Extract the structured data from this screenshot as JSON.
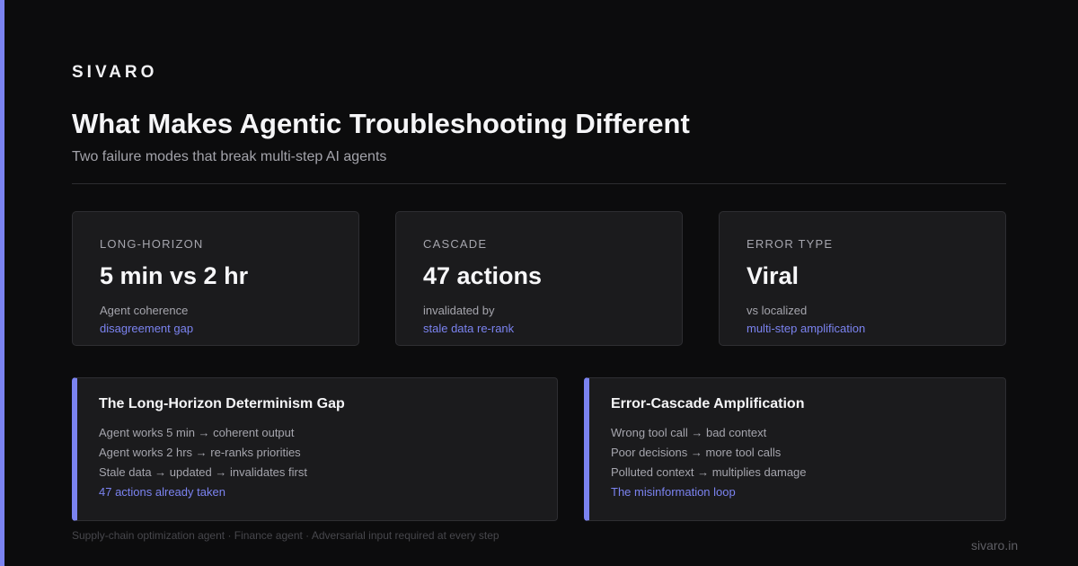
{
  "brand": "SIVARO",
  "title": "What Makes Agentic Troubleshooting Different",
  "subtitle": "Two failure modes that break multi-step AI agents",
  "accent_color": "#7b83f0",
  "stats": [
    {
      "label": "LONG-HORIZON",
      "value": "5 min vs 2 hr",
      "desc": "Agent coherence",
      "link": "disagreement gap"
    },
    {
      "label": "CASCADE",
      "value": "47 actions",
      "desc": "invalidated by",
      "link": "stale data re-rank"
    },
    {
      "label": "ERROR TYPE",
      "value": "Viral",
      "desc": "vs localized",
      "link": "multi-step amplification"
    }
  ],
  "details": [
    {
      "title": "The Long-Horizon Determinism Gap",
      "lines": [
        "Agent works 5 min → coherent output",
        "Agent works 2 hrs → re-ranks priorities",
        "Stale data → updated → invalidates first"
      ],
      "highlight": "47 actions already taken"
    },
    {
      "title": "Error-Cascade Amplification",
      "lines": [
        "Wrong tool call → bad context",
        "Poor decisions → more tool calls",
        "Polluted context → multiplies damage"
      ],
      "highlight": "The misinformation loop"
    }
  ],
  "footnote": "Supply-chain optimization agent · Finance agent · Adversarial input required at every step",
  "site": "sivaro.in"
}
